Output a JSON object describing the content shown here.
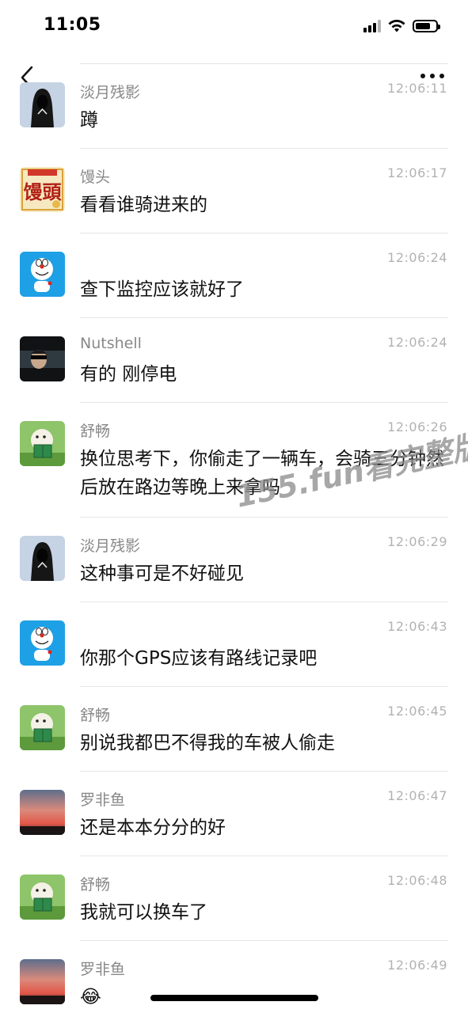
{
  "status_bar": {
    "time": "11:05"
  },
  "nav": {
    "back_icon": "chevron-left-icon",
    "more_icon": "more-dots-icon"
  },
  "messages": [
    {
      "sender": "淡月残影",
      "time": "12:06:11",
      "text": "蹲",
      "avatar": "hooded-figure-avatar"
    },
    {
      "sender": "馒头",
      "time": "12:06:17",
      "text": "看看谁骑进来的",
      "avatar": "mantou-avatar",
      "avatar_text": "馒頭"
    },
    {
      "sender": "",
      "time": "12:06:24",
      "text": "查下监控应该就好了",
      "avatar": "doraemon-avatar"
    },
    {
      "sender": "Nutshell",
      "time": "12:06:24",
      "text": "有的 刚停电",
      "avatar": "sunglasses-man-avatar"
    },
    {
      "sender": "舒畅",
      "time": "12:06:26",
      "text": "换位思考下，你偷走了一辆车，会骑三分钟然后放在路边等晚上来拿吗",
      "avatar": "reading-sheep-avatar"
    },
    {
      "sender": "淡月残影",
      "time": "12:06:29",
      "text": "这种事可是不好碰见",
      "avatar": "hooded-figure-avatar"
    },
    {
      "sender": "",
      "time": "12:06:43",
      "text": "你那个GPS应该有路线记录吧",
      "avatar": "doraemon-avatar"
    },
    {
      "sender": "舒畅",
      "time": "12:06:45",
      "text": "别说我都巴不得我的车被人偷走",
      "avatar": "reading-sheep-avatar"
    },
    {
      "sender": "罗非鱼",
      "time": "12:06:47",
      "text": "还是本本分分的好",
      "avatar": "sunset-sky-avatar"
    },
    {
      "sender": "舒畅",
      "time": "12:06:48",
      "text": "我就可以换车了",
      "avatar": "reading-sheep-avatar"
    },
    {
      "sender": "罗非鱼",
      "time": "12:06:49",
      "text": "😂",
      "avatar": "sunset-sky-avatar"
    }
  ],
  "watermark": "155.fun看完整版",
  "colors": {
    "sender": "#888888",
    "time": "#b2b2b2",
    "divider": "#e6e6e6",
    "doraemon_blue": "#1ea0e6"
  }
}
